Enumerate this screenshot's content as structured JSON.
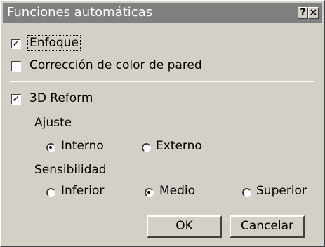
{
  "window": {
    "title": "Funciones automáticas",
    "help_label": "?",
    "close_label": "×"
  },
  "options": {
    "enfoque": {
      "label": "Enfoque",
      "checked": true,
      "check_glyph": "✓"
    },
    "correccion": {
      "label": "Corrección de color de pared",
      "checked": false,
      "check_glyph": ""
    },
    "reform3d": {
      "label": "3D Reform",
      "checked": true,
      "check_glyph": "✓"
    }
  },
  "ajuste": {
    "heading": "Ajuste",
    "interno": "Interno",
    "externo": "Externo",
    "selected": "Interno"
  },
  "sensibilidad": {
    "heading": "Sensibilidad",
    "inferior": "Inferior",
    "medio": "Medio",
    "superior": "Superior",
    "selected": "Medio"
  },
  "buttons": {
    "ok": "OK",
    "cancel": "Cancelar"
  }
}
